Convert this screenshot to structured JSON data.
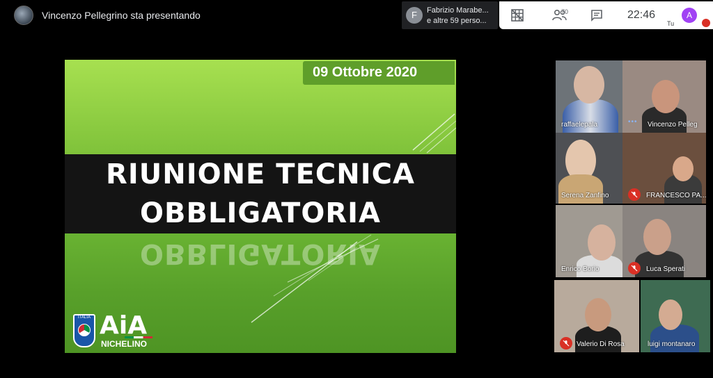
{
  "header": {
    "presenting_text": "Vincenzo Pellegrino sta presentando",
    "notification": {
      "avatar_initial": "F",
      "line1": "Fabrizio Marabe...",
      "line2": "e altre 59 perso..."
    },
    "toolbar": {
      "participant_count": "70",
      "time": "22:46",
      "self_initial": "A",
      "self_label": "Tu"
    }
  },
  "slide": {
    "date": "09 Ottobre 2020",
    "title_line1": "RIUNIONE TECNICA",
    "title_line2": "OBBLIGATORIA",
    "reflection_text": "OBBLIGATORIA",
    "logo_country": "ITALIA",
    "logo_text": "AiA",
    "logo_subtext": "NICHELINO"
  },
  "participants": [
    {
      "name": "raffaelepala",
      "muted": false
    },
    {
      "name": "Vincenzo Pelleg",
      "muted": false,
      "speaking": true
    },
    {
      "name": "Serena Zanfino",
      "muted": false
    },
    {
      "name": "FRANCESCO PA...",
      "muted": true
    },
    {
      "name": "Enrico Borio",
      "muted": false
    },
    {
      "name": "Luca Sperati",
      "muted": true
    },
    {
      "name": "Valerio Di Rosa",
      "muted": true
    },
    {
      "name": "luigi montanaro",
      "muted": false
    }
  ],
  "icons": {
    "layout": "grid-layout-icon",
    "people": "people-icon",
    "chat": "chat-icon",
    "mic_off": "mic-off-icon"
  },
  "colors": {
    "accent_mute": "#d93025",
    "self_avatar": "#a142f4",
    "slide_green": "#7cc23a"
  }
}
